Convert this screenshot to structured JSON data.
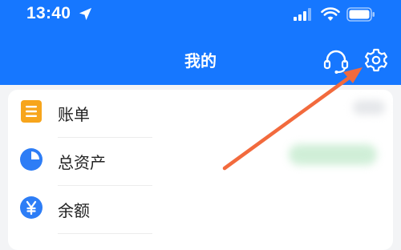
{
  "status_bar": {
    "time": "13:40",
    "icons": [
      "location-arrow-icon",
      "cellular-signal-icon",
      "wifi-icon",
      "battery-icon"
    ]
  },
  "header": {
    "title": "我的",
    "actions": [
      "customer-service-icon",
      "gear-icon"
    ],
    "background_color": "#1677ff"
  },
  "menu": {
    "items": [
      {
        "label": "账单",
        "icon": "bill-icon",
        "color": "#f7a51c"
      },
      {
        "label": "总资产",
        "icon": "pie-chart-icon",
        "color": "#2d7df6"
      },
      {
        "label": "余额",
        "icon": "yen-icon",
        "color": "#2d7df6"
      }
    ]
  },
  "annotation": {
    "arrow_color": "#f26a3d",
    "points_to": "gear-icon"
  }
}
